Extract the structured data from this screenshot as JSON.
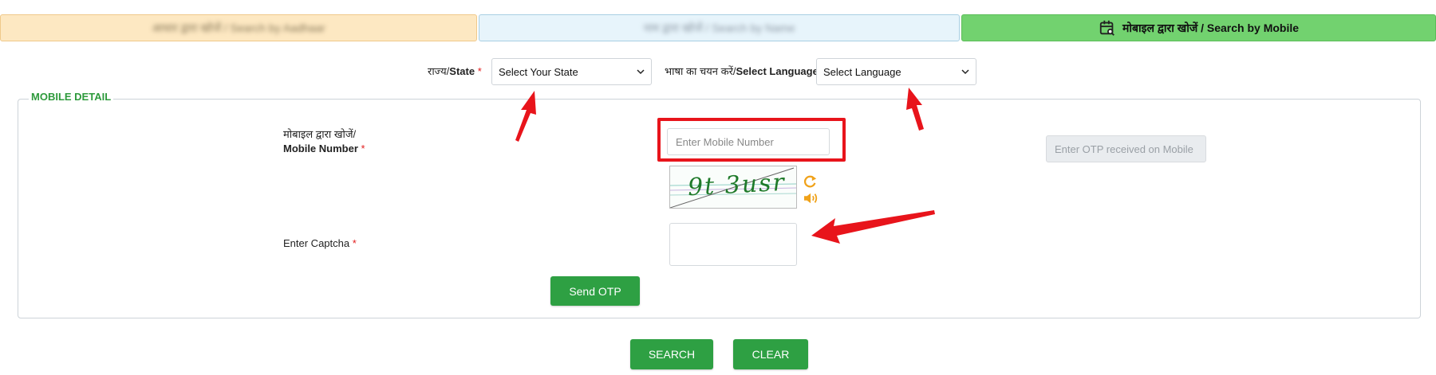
{
  "tabs": [
    {
      "label": "आधार द्वारा खोजें / Search by Aadhaar"
    },
    {
      "label": "नाम द्वारा खोजें / Search by Name"
    },
    {
      "label": "मोबाइल द्वारा खोजें / Search by Mobile",
      "icon": "calendar-search-icon",
      "active": true
    }
  ],
  "state": {
    "label_hi": "राज्य/",
    "label_en": "State",
    "required": "*",
    "selected": "Select Your State"
  },
  "language": {
    "label_hi": "भाषा का चयन करें/",
    "label_en": "Select Language",
    "selected": "Select Language"
  },
  "mobile_detail": {
    "legend": "MOBILE DETAIL",
    "mobile_label_hi": "मोबाइल द्वारा खोजें/",
    "mobile_label_en": "Mobile Number",
    "required": "*",
    "mobile_placeholder": "Enter Mobile Number",
    "otp_placeholder": "Enter OTP received on Mobile",
    "captcha_text": "9t 3usr",
    "captcha_label": "Enter Captcha",
    "send_otp": "Send OTP"
  },
  "actions": {
    "search": "SEARCH",
    "clear": "CLEAR"
  },
  "colors": {
    "accent_green": "#2ea043",
    "legend_green": "#2e9a3c",
    "highlight_red": "#e8141b",
    "required_red": "#e21d1d"
  }
}
